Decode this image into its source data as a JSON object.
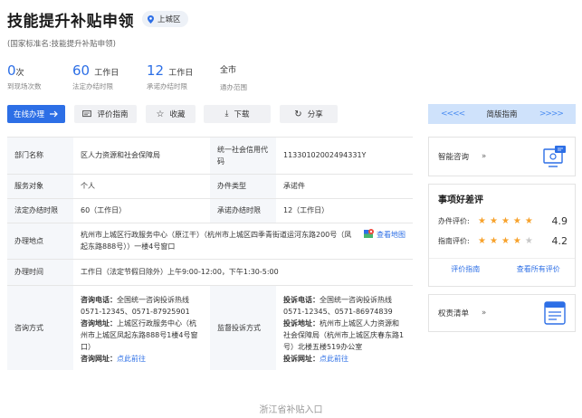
{
  "header": {
    "title": "技能提升补贴申领",
    "location": "上城区",
    "standard_name": "(国家标准名:技能提升补贴申领)"
  },
  "stats": [
    {
      "value": "0",
      "unit": "次",
      "label": "到现场次数"
    },
    {
      "value": "60",
      "unit": "工作日",
      "label": "法定办结时限"
    },
    {
      "value": "12",
      "unit": "工作日",
      "label": "承诺办结时限"
    },
    {
      "value": "",
      "unit": "全市",
      "label": "通办范围"
    }
  ],
  "actions": {
    "apply": "在线办理",
    "review": "评价指南",
    "favorite": "收藏",
    "download": "下载",
    "share": "分享"
  },
  "guide": {
    "label": "简版指南",
    "left_chevrons": "<<<<",
    "right_chevrons": ">>>>"
  },
  "info": {
    "dept_label": "部门名称",
    "dept_value": "区人力资源和社会保障局",
    "credit_label": "统一社会信用代码",
    "credit_value": "11330102002494331Y",
    "service_label": "服务对象",
    "service_value": "个人",
    "type_label": "办件类型",
    "type_value": "承诺件",
    "legal_label": "法定办结时限",
    "legal_value": "60（工作日）",
    "promise_label": "承诺办结时限",
    "promise_value": "12（工作日）",
    "place_label": "办理地点",
    "place_value": "杭州市上城区行政服务中心（原江干）（杭州市上城区四季青街道运河东路200号（凤起东路888号））一楼4号窗口",
    "map_link": "查看地图",
    "time_label": "办理时间",
    "time_value": "工作日（法定节假日除外）上午9:00-12:00，下午1:30-5:00",
    "consult_label": "咨询方式",
    "consult_phone_key": "咨询电话：",
    "consult_phone": "全国统一咨询投诉热线0571-12345、0571-87925901",
    "consult_addr_key": "咨询地址：",
    "consult_addr": "上城区行政服务中心（杭州市上城区凤起东路888号1楼4号窗口）",
    "consult_web_key": "咨询网址：",
    "consult_web": "点此前往",
    "supervise_label": "监督投诉方式",
    "complain_phone_key": "投诉电话：",
    "complain_phone": "全国统一咨询投诉热线0571-12345、0571-86974839",
    "complain_addr_key": "投诉地址：",
    "complain_addr": "杭州市上城区人力资源和社会保障局（杭州市上城区庆春东路1号）北楼五楼519办公室",
    "complain_web_key": "投诉网址：",
    "complain_web": "点此前往"
  },
  "sidebar": {
    "smart_consult": "智能咨询",
    "smart_arrow": "»",
    "review_title": "事项好差评",
    "office_label": "办件评价:",
    "office_score": "4.9",
    "office_stars": 5,
    "guide_label": "指南评价:",
    "guide_score": "4.2",
    "guide_stars": 4,
    "review_guide_link": "评价指南",
    "all_reviews_link": "查看所有评价",
    "power_list": "权责清单",
    "power_arrow": "»"
  },
  "footer": {
    "text": "浙江省补贴入口"
  },
  "colors": {
    "accent": "#2d6fe6",
    "star": "#f7a22c"
  }
}
